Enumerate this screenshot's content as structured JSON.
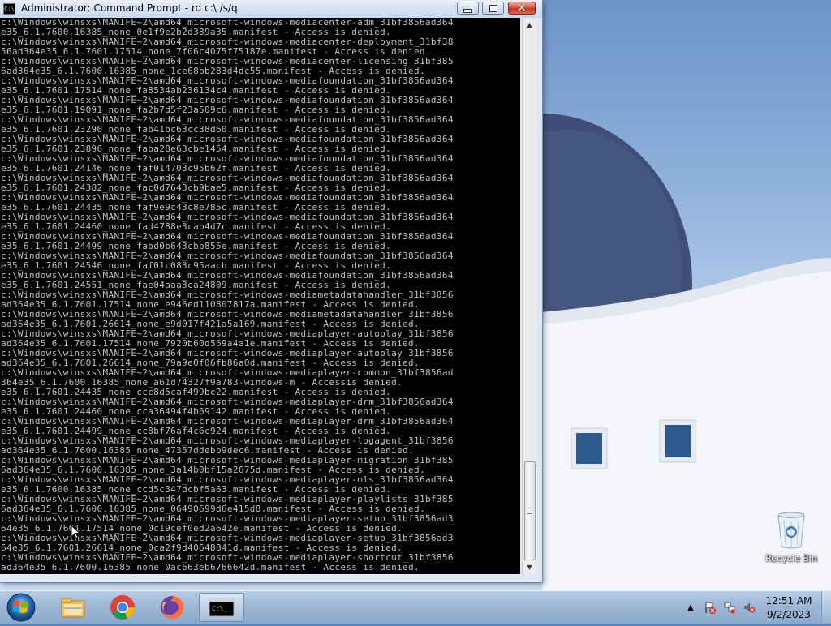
{
  "window": {
    "title": "Administrator: Command Prompt - rd  c:\\ /s/q",
    "icon_text": "C:\\",
    "minimize": "minimize-button",
    "maximize": "maximize-button",
    "close_glyph": "✕"
  },
  "console": {
    "lines": [
      "c:\\Windows\\winsxs\\MANIFE~2\\amd64_microsoft-windows-mediacenter-adm_31bf3856ad364",
      "e35_6.1.7600.16385_none_0e1f9e2b2d389a35.manifest - Access is denied.",
      "c:\\Windows\\winsxs\\MANIFE~2\\amd64_microsoft-windows-mediacenter-deployment_31bf38",
      "56ad364e35_6.1.7601.17514_none_7f06c4075f75187e.manifest - Access is denied.",
      "c:\\Windows\\winsxs\\MANIFE~2\\amd64_microsoft-windows-mediacenter-licensing_31bf385",
      "6ad364e35_6.1.7600.16385_none_1ce68bb283d4dc55.manifest - Access is denied.",
      "c:\\Windows\\winsxs\\MANIFE~2\\amd64_microsoft-windows-mediafoundation_31bf3856ad364",
      "e35_6.1.7601.17514_none_fa8534ab236134c4.manifest - Access is denied.",
      "c:\\Windows\\winsxs\\MANIFE~2\\amd64_microsoft-windows-mediafoundation_31bf3856ad364",
      "e35_6.1.7601.19091_none_fa2b7d5f23a509c6.manifest - Access is denied.",
      "c:\\Windows\\winsxs\\MANIFE~2\\amd64_microsoft-windows-mediafoundation_31bf3856ad364",
      "e35_6.1.7601.23290_none_fab41bc63cc38d60.manifest - Access is denied.",
      "c:\\Windows\\winsxs\\MANIFE~2\\amd64_microsoft-windows-mediafoundation_31bf3856ad364",
      "e35_6.1.7601.23896_none_faba28e63cbe1454.manifest - Access is denied.",
      "c:\\Windows\\winsxs\\MANIFE~2\\amd64_microsoft-windows-mediafoundation_31bf3856ad364",
      "e35_6.1.7601.24146_none_faf014703c95b62f.manifest - Access is denied.",
      "c:\\Windows\\winsxs\\MANIFE~2\\amd64_microsoft-windows-mediafoundation_31bf3856ad364",
      "e35_6.1.7601.24382_none_fac0d7643cb9bae5.manifest - Access is denied.",
      "c:\\Windows\\winsxs\\MANIFE~2\\amd64_microsoft-windows-mediafoundation_31bf3856ad364",
      "e35_6.1.7601.24435_none_faf9e9c43c8e785c.manifest - Access is denied.",
      "c:\\Windows\\winsxs\\MANIFE~2\\amd64_microsoft-windows-mediafoundation_31bf3856ad364",
      "e35_6.1.7601.24460_none_fad4788e3cab4d7c.manifest - Access is denied.",
      "c:\\Windows\\winsxs\\MANIFE~2\\amd64_microsoft-windows-mediafoundation_31bf3856ad364",
      "e35_6.1.7601.24499_none_fabd0b643cbb855e.manifest - Access is denied.",
      "c:\\Windows\\winsxs\\MANIFE~2\\amd64_microsoft-windows-mediafoundation_31bf3856ad364",
      "e35_6.1.7601.24546_none_faf01c083c95aacb.manifest - Access is denied.",
      "c:\\Windows\\winsxs\\MANIFE~2\\amd64_microsoft-windows-mediafoundation_31bf3856ad364",
      "e35_6.1.7601.24551_none_fae04aaa3ca24809.manifest - Access is denied.",
      "c:\\Windows\\winsxs\\MANIFE~2\\amd64_microsoft-windows-mediametadatahandler_31bf3856",
      "ad364e35_6.1.7601.17514_none_e946ed110807817a.manifest - Access is denied.",
      "c:\\Windows\\winsxs\\MANIFE~2\\amd64_microsoft-windows-mediametadatahandler_31bf3856",
      "ad364e35_6.1.7601.26614_none_e9d017f421a5a169.manifest - Access is denied.",
      "c:\\Windows\\winsxs\\MANIFE~2\\amd64_microsoft-windows-mediaplayer-autoplay_31bf3856",
      "ad364e35_6.1.7601.17514_none_7920b60d569a4a1e.manifest - Access is denied.",
      "c:\\Windows\\winsxs\\MANIFE~2\\amd64_microsoft-windows-mediaplayer-autoplay_31bf3856",
      "ad364e35_6.1.7601.26614_none_79a9e0f06fb86a0d.manifest - Access is denied.",
      "c:\\Windows\\winsxs\\MANIFE~2\\amd64_microsoft-windows-mediaplayer-common_31bf3856ad",
      "364e35_6.1.7600.16385_none_a61d74327f9a783-windows-m - Accessis denied.",
      "e35_6.1.7601.24435_none_ccc8d5caf499bc22.manifest - Access is denied.",
      "c:\\Windows\\winsxs\\MANIFE~2\\amd64_microsoft-windows-mediaplayer-drm_31bf3856ad364",
      "e35_6.1.7601.24460_none_cca36494f4b69142.manifest - Access is denied.",
      "c:\\Windows\\winsxs\\MANIFE~2\\amd64_microsoft-windows-mediaplayer-drm_31bf3856ad364",
      "e35_6.1.7601.24499_none_cc8bf76af4c6c924.manifest - Access is denied.",
      "c:\\Windows\\winsxs\\MANIFE~2\\amd64_microsoft-windows-mediaplayer-logagent_31bf3856",
      "ad364e35_6.1.7600.16385_none_47357ddebb9dec6.manifest - Access is denied.",
      "c:\\Windows\\winsxs\\MANIFE~2\\amd64_microsoft-windows-mediaplayer-migration_31bf385",
      "6ad364e35_6.1.7600.16385_none_3a14b0bf15a2675d.manifest - Access is denied.",
      "c:\\Windows\\winsxs\\MANIFE~2\\amd64_microsoft-windows-mediaplayer-mls_31bf3856ad364",
      "e35_6.1.7600.16385_none_ccd5c347dcbf5a63.manifest - Access is denied.",
      "c:\\Windows\\winsxs\\MANIFE~2\\amd64_microsoft-windows-mediaplayer-playlists_31bf385",
      "6ad364e35_6.1.7600.16385_none_06490699d6e415d8.manifest - Access is denied.",
      "c:\\Windows\\winsxs\\MANIFE~2\\amd64_microsoft-windows-mediaplayer-setup_31bf3856ad3",
      "64e35_6.1.7601.17514_none_0c19cef0ed2a642e.manifest - Access is denied.",
      "c:\\Windows\\winsxs\\MANIFE~2\\amd64_microsoft-windows-mediaplayer-setup_31bf3856ad3",
      "64e35_6.1.7601.26614_none_0ca2f9d40648841d.manifest - Access is denied.",
      "c:\\Windows\\winsxs\\MANIFE~2\\amd64_microsoft-windows-mediaplayer-shortcut_31bf3856",
      "ad364e35_6.1.7600.16385_none_0ac663eb6766642d.manifest - Access is denied."
    ]
  },
  "desktop": {
    "recycle_bin_label": "Recycle Bin"
  },
  "taskbar": {
    "start_icon": "windows-start-icon",
    "pinned": [
      {
        "name": "file-explorer-icon",
        "active": false
      },
      {
        "name": "chrome-icon",
        "active": false
      },
      {
        "name": "firefox-icon",
        "active": false
      },
      {
        "name": "command-prompt-icon",
        "active": true
      }
    ],
    "tray_icons": [
      "show-hidden-icons-arrow",
      "action-center-flag-icon",
      "network-icon",
      "volume-muted-icon"
    ],
    "clock_time": "12:51 AM",
    "clock_date": "9/2/2023"
  },
  "colors": {
    "console_bg": "#000000",
    "console_text": "#c0c0c0",
    "close_button": "#c23b26",
    "taskbar": "#9fb9d6"
  }
}
